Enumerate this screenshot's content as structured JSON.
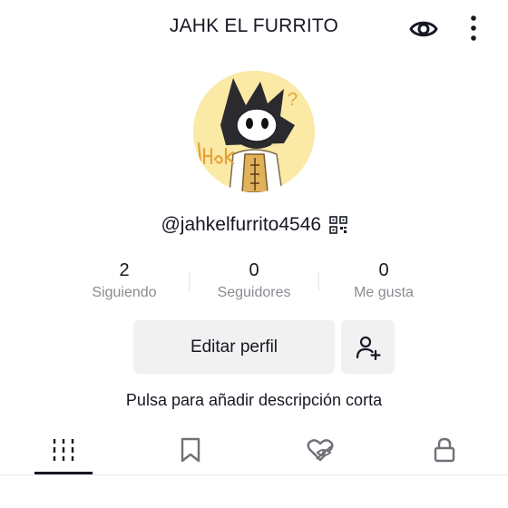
{
  "header": {
    "title": "JAHK EL FURRITO",
    "eye_icon": "eye-icon",
    "more_icon": "more-vertical-icon"
  },
  "profile": {
    "avatar_icon": "profile-avatar",
    "handle": "@jahkelfurrito4546",
    "qr_icon": "qr-code-icon"
  },
  "stats": [
    {
      "value": "2",
      "label": "Siguiendo"
    },
    {
      "value": "0",
      "label": "Seguidores"
    },
    {
      "value": "0",
      "label": "Me gusta"
    }
  ],
  "actions": {
    "edit_label": "Editar perfil",
    "add_friend_icon": "add-user-icon"
  },
  "bio": {
    "placeholder": "Pulsa para añadir descripción corta"
  },
  "tabs": [
    {
      "icon": "videos-grid-icon",
      "active": true
    },
    {
      "icon": "bookmark-icon",
      "active": false
    },
    {
      "icon": "liked-hidden-icon",
      "active": false
    },
    {
      "icon": "lock-icon",
      "active": false
    }
  ],
  "colors": {
    "text": "#161823",
    "secondary_text": "#8a8b91",
    "button_bg": "#f1f1f2",
    "avatar_bg": "#fbe9a6"
  }
}
